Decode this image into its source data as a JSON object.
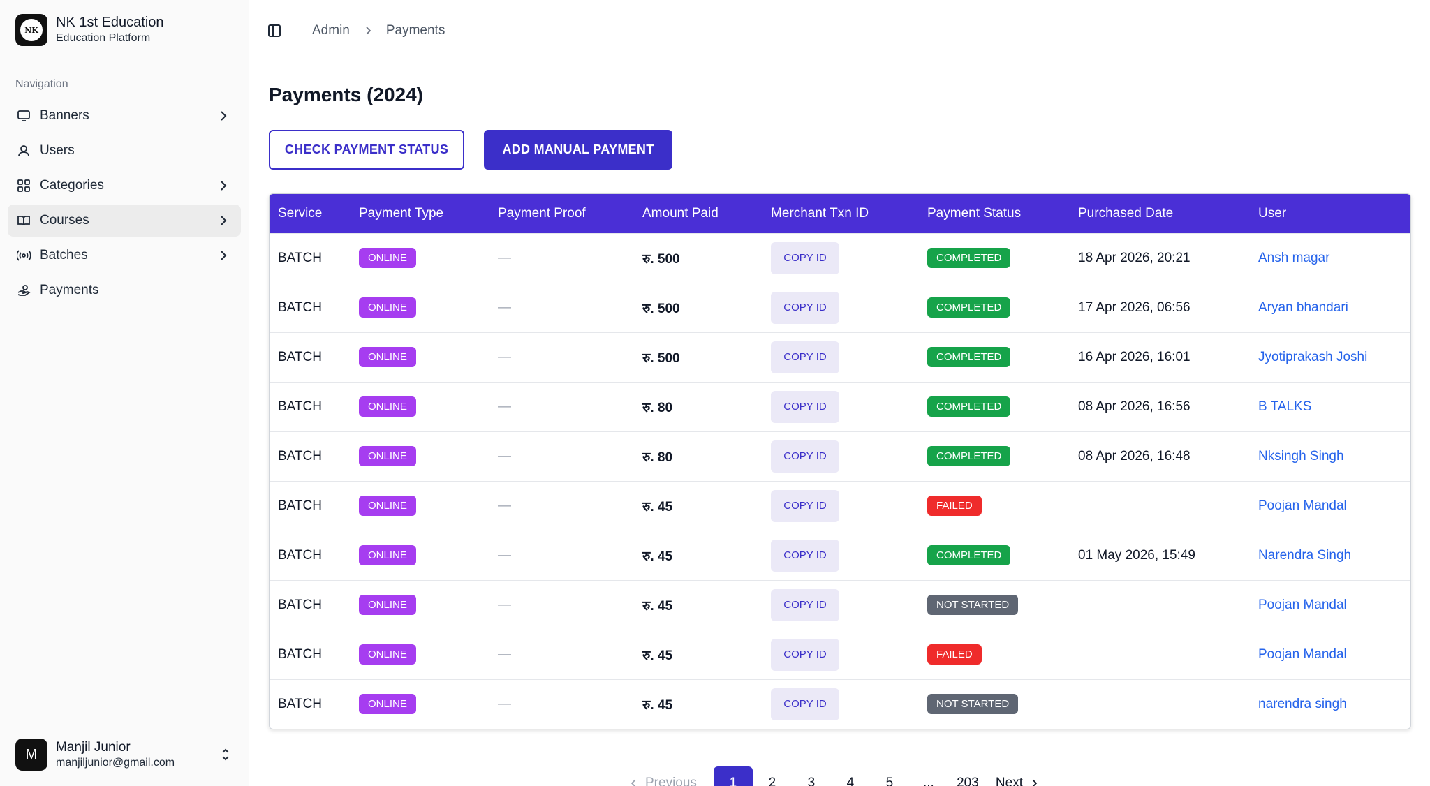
{
  "brand": {
    "name": "NK 1st Education",
    "subtitle": "Education Platform",
    "logo_text": "NK"
  },
  "sidebar": {
    "section_label": "Navigation",
    "items": [
      {
        "label": "Banners",
        "icon": "monitor-icon",
        "has_chevron": true
      },
      {
        "label": "Users",
        "icon": "user-icon",
        "has_chevron": false
      },
      {
        "label": "Categories",
        "icon": "grid-icon",
        "has_chevron": true
      },
      {
        "label": "Courses",
        "icon": "book-open-icon",
        "has_chevron": true
      },
      {
        "label": "Batches",
        "icon": "broadcast-icon",
        "has_chevron": true
      },
      {
        "label": "Payments",
        "icon": "payment-hand-icon",
        "has_chevron": false
      }
    ],
    "user": {
      "initial": "M",
      "name": "Manjil Junior",
      "email": "manjiljunior@gmail.com"
    }
  },
  "breadcrumb": {
    "parent": "Admin",
    "current": "Payments"
  },
  "page": {
    "title": "Payments (2024)"
  },
  "actions": {
    "check_status": "CHECK PAYMENT STATUS",
    "add_manual": "ADD MANUAL PAYMENT"
  },
  "table": {
    "headers": [
      "Service",
      "Payment Type",
      "Payment Proof",
      "Amount Paid",
      "Merchant Txn ID",
      "Payment Status",
      "Purchased Date",
      "User"
    ],
    "rows": [
      {
        "service": "BATCH",
        "type": "ONLINE",
        "proof": "—",
        "amount": "रु. 500",
        "copy": "COPY ID",
        "status": "COMPLETED",
        "date": "18 Apr 2026, 20:21",
        "user": "Ansh magar"
      },
      {
        "service": "BATCH",
        "type": "ONLINE",
        "proof": "—",
        "amount": "रु. 500",
        "copy": "COPY ID",
        "status": "COMPLETED",
        "date": "17 Apr 2026, 06:56",
        "user": "Aryan bhandari"
      },
      {
        "service": "BATCH",
        "type": "ONLINE",
        "proof": "—",
        "amount": "रु. 500",
        "copy": "COPY ID",
        "status": "COMPLETED",
        "date": "16 Apr 2026, 16:01",
        "user": "Jyotiprakash Joshi"
      },
      {
        "service": "BATCH",
        "type": "ONLINE",
        "proof": "—",
        "amount": "रु. 80",
        "copy": "COPY ID",
        "status": "COMPLETED",
        "date": "08 Apr 2026, 16:56",
        "user": "B TALKS"
      },
      {
        "service": "BATCH",
        "type": "ONLINE",
        "proof": "—",
        "amount": "रु. 80",
        "copy": "COPY ID",
        "status": "COMPLETED",
        "date": "08 Apr 2026, 16:48",
        "user": "Nksingh Singh"
      },
      {
        "service": "BATCH",
        "type": "ONLINE",
        "proof": "—",
        "amount": "रु. 45",
        "copy": "COPY ID",
        "status": "FAILED",
        "date": "",
        "user": "Poojan Mandal"
      },
      {
        "service": "BATCH",
        "type": "ONLINE",
        "proof": "—",
        "amount": "रु. 45",
        "copy": "COPY ID",
        "status": "COMPLETED",
        "date": "01 May 2026, 15:49",
        "user": "Narendra Singh"
      },
      {
        "service": "BATCH",
        "type": "ONLINE",
        "proof": "—",
        "amount": "रु. 45",
        "copy": "COPY ID",
        "status": "NOT STARTED",
        "date": "",
        "user": "Poojan Mandal"
      },
      {
        "service": "BATCH",
        "type": "ONLINE",
        "proof": "—",
        "amount": "रु. 45",
        "copy": "COPY ID",
        "status": "FAILED",
        "date": "",
        "user": "Poojan Mandal"
      },
      {
        "service": "BATCH",
        "type": "ONLINE",
        "proof": "—",
        "amount": "रु. 45",
        "copy": "COPY ID",
        "status": "NOT STARTED",
        "date": "",
        "user": "narendra singh"
      }
    ]
  },
  "pagination": {
    "previous": "Previous",
    "pages": [
      "1",
      "2",
      "3",
      "4",
      "5",
      "...",
      "203"
    ],
    "active": "1",
    "next": "Next"
  },
  "colors": {
    "primary": "#3b2fc9",
    "header": "#4a2fd6",
    "online": "#a63df0",
    "completed": "#16a34a",
    "failed": "#ef2b2b",
    "not_started": "#5f6673",
    "link": "#2563eb"
  }
}
